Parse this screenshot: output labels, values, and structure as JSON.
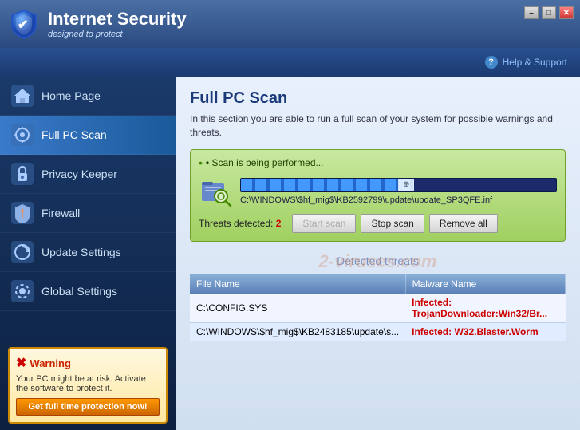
{
  "app": {
    "title": "Internet Security",
    "subtitle": "designed to protect"
  },
  "window_controls": {
    "minimize": "–",
    "maximize": "□",
    "close": "✕"
  },
  "helpbar": {
    "help_label": "Help & Support"
  },
  "sidebar": {
    "items": [
      {
        "id": "home",
        "label": "Home Page",
        "active": false
      },
      {
        "id": "fullscan",
        "label": "Full PC Scan",
        "active": true
      },
      {
        "id": "privacy",
        "label": "Privacy Keeper",
        "active": false
      },
      {
        "id": "firewall",
        "label": "Firewall",
        "active": false
      },
      {
        "id": "update",
        "label": "Update Settings",
        "active": false
      },
      {
        "id": "global",
        "label": "Global Settings",
        "active": false
      }
    ],
    "warning": {
      "title": "Warning",
      "text": "Your PC might be at risk. Activate the software to protect it.",
      "button": "Get full time protection now!"
    }
  },
  "content": {
    "title": "Full PC Scan",
    "description": "In this section you are able to run a full scan of your system for possible warnings and threats.",
    "scan_status": {
      "status_text": "• Scan is being performed...",
      "file_path": "C:\\WINDOWS\\$hf_mig$\\KB2592799\\update\\update_SP3QFE.inf",
      "threats_detected_label": "Threats detected:",
      "threats_count": "2",
      "start_scan": "Start scan",
      "stop_scan": "Stop scan",
      "remove_all": "Remove all"
    },
    "detected_threats": {
      "header": "Detected threats",
      "watermark": "2-viruses.com",
      "col_filename": "File Name",
      "col_malware": "Malware Name",
      "rows": [
        {
          "file": "C:\\CONFIG.SYS",
          "malware": "Infected: TrojanDownloader:Win32/Br..."
        },
        {
          "file": "C:\\WINDOWS\\$hf_mig$\\KB2483185\\update\\s...",
          "malware": "Infected: W32.Blaster.Worm"
        }
      ]
    }
  }
}
